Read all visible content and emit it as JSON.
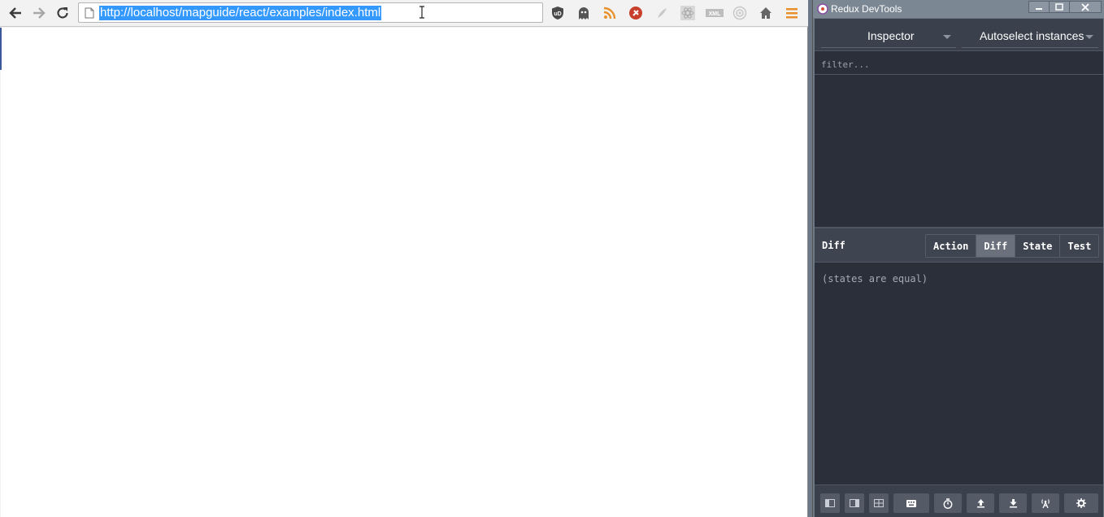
{
  "browser": {
    "url": "http://localhost/mapguide/react/examples/index.html",
    "nav": {
      "back_icon": "back-arrow-icon",
      "forward_icon": "forward-arrow-icon",
      "reload_icon": "reload-icon"
    },
    "extensions": [
      "ublock-icon",
      "ghostery-icon",
      "rss-icon",
      "extension-red-icon",
      "extension-grey-icon",
      "react-devtools-icon",
      "xml-icon",
      "radar-icon",
      "home-icon",
      "menu-icon"
    ]
  },
  "devtools": {
    "window_title": "Redux DevTools",
    "monitor_select": "Inspector",
    "instance_select": "Autoselect instances",
    "filter_placeholder": "filter...",
    "tab_title": "Diff",
    "tabs": [
      {
        "label": "Action",
        "active": false
      },
      {
        "label": "Diff",
        "active": true
      },
      {
        "label": "State",
        "active": false
      },
      {
        "label": "Test",
        "active": false
      }
    ],
    "diff_message": "(states are equal)",
    "bottom_buttons": [
      "layout-left-icon",
      "layout-right-icon",
      "layout-bottom-icon",
      "keyboard-icon",
      "timer-icon",
      "upload-icon",
      "download-icon",
      "remote-icon",
      "settings-icon"
    ]
  }
}
